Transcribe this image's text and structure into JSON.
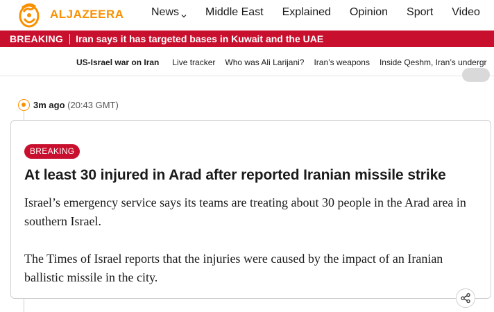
{
  "header": {
    "logo_text": "ALJAZEERA",
    "accent_color": "#fa9000",
    "nav": [
      {
        "label": "News",
        "has_dropdown": true
      },
      {
        "label": "Middle East"
      },
      {
        "label": "Explained"
      },
      {
        "label": "Opinion"
      },
      {
        "label": "Sport"
      },
      {
        "label": "Video"
      }
    ]
  },
  "breaking_bar": {
    "label": "BREAKING",
    "headline": "Iran says it has targeted bases in Kuwait and the UAE",
    "color": "#c8102e"
  },
  "subnav": {
    "items": [
      "US-Israel war on Iran",
      "Live tracker",
      "Who was Ali Larijani?",
      "Iran’s weapons",
      "Inside Qeshm, Iran’s undergr"
    ]
  },
  "post": {
    "time_ago": "3m ago",
    "timestamp": "(20:43 GMT)",
    "badge": "BREAKING",
    "title": "At least 30 injured in Arad after reported Iranian missile strike",
    "paragraphs": [
      "Israel’s emergency service says its teams are treating about 30 people in the Arad area in southern Israel.",
      "The Times of Israel reports that the injuries were caused by the impact of an Iranian ballistic missile in the city."
    ],
    "share_icon": "share-icon"
  }
}
